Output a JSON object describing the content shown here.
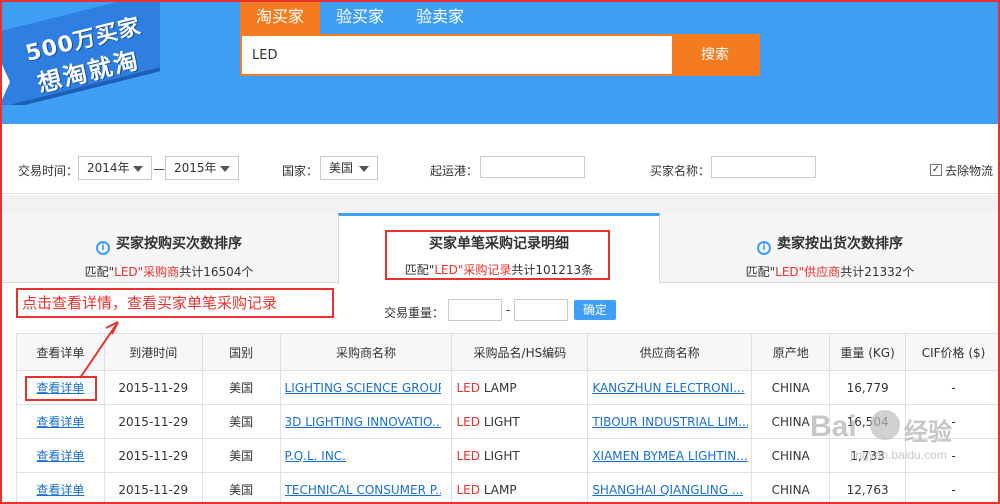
{
  "header": {
    "logo_line1": "500万买家",
    "logo_line2": "想淘就淘",
    "tabs": [
      "淘买家",
      "验买家",
      "验卖家"
    ],
    "search_value": "LED",
    "search_button": "搜索"
  },
  "filters": {
    "trade_time_label": "交易时间：",
    "year_from": "2014年",
    "dash": "—",
    "year_to": "2015年",
    "country_label": "国家：",
    "country_value": "美国",
    "port_label": "起运港：",
    "buyer_label": "买家名称：",
    "remove_logistics_label": "去除物流",
    "remove_logistics_checked": "✓"
  },
  "sections": [
    {
      "title": "买家按购买次数排序",
      "pre": "匹配\"",
      "kw": "LED",
      "mid": "\"采购商",
      "post": "共计16504个"
    },
    {
      "title": "买家单笔采购记录明细",
      "pre": "匹配\"",
      "kw": "LED",
      "mid": "\"采购记录",
      "post": "共计101213条"
    },
    {
      "title": "卖家按出货次数排序",
      "pre": "匹配\"",
      "kw": "LED",
      "mid": "\"供应商",
      "post": "共计21332个"
    }
  ],
  "annotation": {
    "callout": "点击查看详情，查看买家单笔采购记录"
  },
  "weight_filter": {
    "label": "交易重量：",
    "dash": "-",
    "confirm": "确定"
  },
  "table": {
    "headers": [
      "查看详单",
      "到港时间",
      "国别",
      "采购商名称",
      "采购品名/HS编码",
      "供应商名称",
      "原产地",
      "重量 (KG)",
      "CIF价格 ($)"
    ],
    "rows": [
      {
        "detail": "查看详单",
        "date": "2015-11-29",
        "country": "美国",
        "buyer": "LIGHTING SCIENCE GROUP",
        "kw": "LED",
        "product": " LAMP",
        "supplier": "KANGZHUN ELECTRONI...",
        "origin": "CHINA",
        "weight": "16,779",
        "cif": "-"
      },
      {
        "detail": "查看详单",
        "date": "2015-11-29",
        "country": "美国",
        "buyer": "3D LIGHTING INNOVATIO...",
        "kw": "LED",
        "product": " LIGHT",
        "supplier": "TIBOUR INDUSTRIAL LIM...",
        "origin": "CHINA",
        "weight": "16,504",
        "cif": "-"
      },
      {
        "detail": "查看详单",
        "date": "2015-11-29",
        "country": "美国",
        "buyer": "P.Q.L. INC.",
        "kw": "LED",
        "product": " LIGHT",
        "supplier": "XIAMEN BYMEA LIGHTIN...",
        "origin": "CHINA",
        "weight": "1,733",
        "cif": "-"
      },
      {
        "detail": "查看详单",
        "date": "2015-11-29",
        "country": "美国",
        "buyer": "TECHNICAL CONSUMER P...",
        "kw": "LED",
        "product": " LAMP",
        "supplier": "SHANGHAI QIANGLING ...",
        "origin": "CHINA",
        "weight": "12,763",
        "cif": "-"
      }
    ]
  },
  "watermark": {
    "brand": "Bai",
    "jingyan": "经验",
    "url": "jingyan.baidu.com"
  },
  "colors": {
    "header_blue": "#3f9ef6",
    "accent_orange": "#f57b20",
    "annotation_red": "#e8322f",
    "link_blue": "#1a6fd0"
  }
}
